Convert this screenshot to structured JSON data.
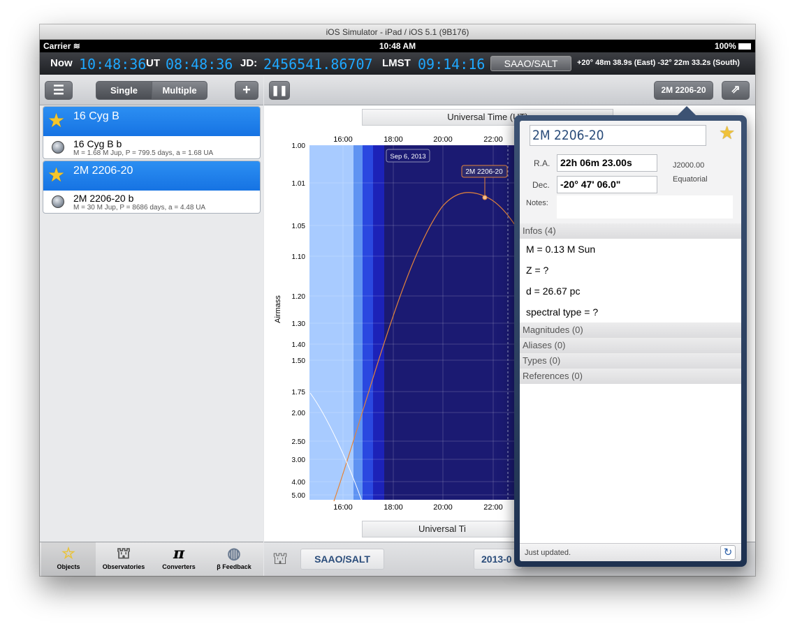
{
  "window": {
    "title": "iOS Simulator - iPad / iOS 5.1 (9B176)"
  },
  "statusbar": {
    "carrier": "Carrier",
    "time": "10:48 AM",
    "battery": "100%"
  },
  "timebar": {
    "now_label": "Now",
    "now_value": "10:48:36",
    "ut_label": "UT",
    "ut_value": "08:48:36",
    "jd_label": "JD:",
    "jd_value": "2456541.86707",
    "lmst_label": "LMST",
    "lmst_value": "09:14:16",
    "observatory": "SAAO/SALT",
    "coords": "+20° 48m 38.9s (East) -32° 22m 33.2s (South)"
  },
  "leftnav": {
    "single": "Single",
    "multiple": "Multiple",
    "add": "+"
  },
  "objects": [
    {
      "name": "16 Cyg B",
      "planet": "16 Cyg B b",
      "params": "M = 1.68 M Jup, P = 799.5 days, a = 1.68 UA"
    },
    {
      "name": "2M 2206-20",
      "planet": "2M 2206-20 b",
      "params": "M = 30 M Jup, P = 8686 days, a = 4.48 UA"
    }
  ],
  "tabs": [
    {
      "label": "Objects",
      "icon": "star-icon"
    },
    {
      "label": "Observatories",
      "icon": "telescope-icon"
    },
    {
      "label": "Converters",
      "icon": "pi-icon"
    },
    {
      "label": "β Feedback",
      "icon": "globe-icon"
    }
  ],
  "rightnav": {
    "object_button": "2M 2206-20"
  },
  "plot": {
    "top_title": "Universal Time (UT)",
    "bottom_title": "Universal Ti",
    "ylabel": "Airmass",
    "x_ticks": [
      "16:00",
      "18:00",
      "20:00",
      "22:00"
    ],
    "y_ticks": [
      "1.00",
      "1.01",
      "1.05",
      "1.10",
      "1.20",
      "1.30",
      "1.40",
      "1.50",
      "1.75",
      "2.00",
      "2.50",
      "3.00",
      "4.00",
      "5.00"
    ],
    "date_label": "Sep 6, 2013",
    "target_label": "2M 2206-20",
    "colors": {
      "day": "#a8cbff",
      "twilight1": "#5f93f2",
      "twilight2": "#2a48e0",
      "twilight3": "#1c22b8",
      "night": "#1b1a72",
      "target_curve": "#e4843a",
      "moon_curve": "#ffffff"
    }
  },
  "bottombar": {
    "observatory": "SAAO/SALT",
    "date_partial": "2013-0"
  },
  "popover": {
    "name": "2M 2206-20",
    "ra_label": "R.A.",
    "ra_value": "22h 06m 23.00s",
    "dec_label": "Dec.",
    "dec_value": "-20° 47' 06.0\"",
    "epoch": "J2000.00",
    "frame": "Equatorial",
    "notes_label": "Notes:",
    "infos_header": "Infos (4)",
    "infos": [
      "M = 0.13 M Sun",
      "Z = ?",
      "d = 26.67 pc",
      "spectral type = ?"
    ],
    "sections": [
      "Magnitudes (0)",
      "Aliases (0)",
      "Types (0)",
      "References (0)"
    ],
    "footer": "Just updated."
  }
}
